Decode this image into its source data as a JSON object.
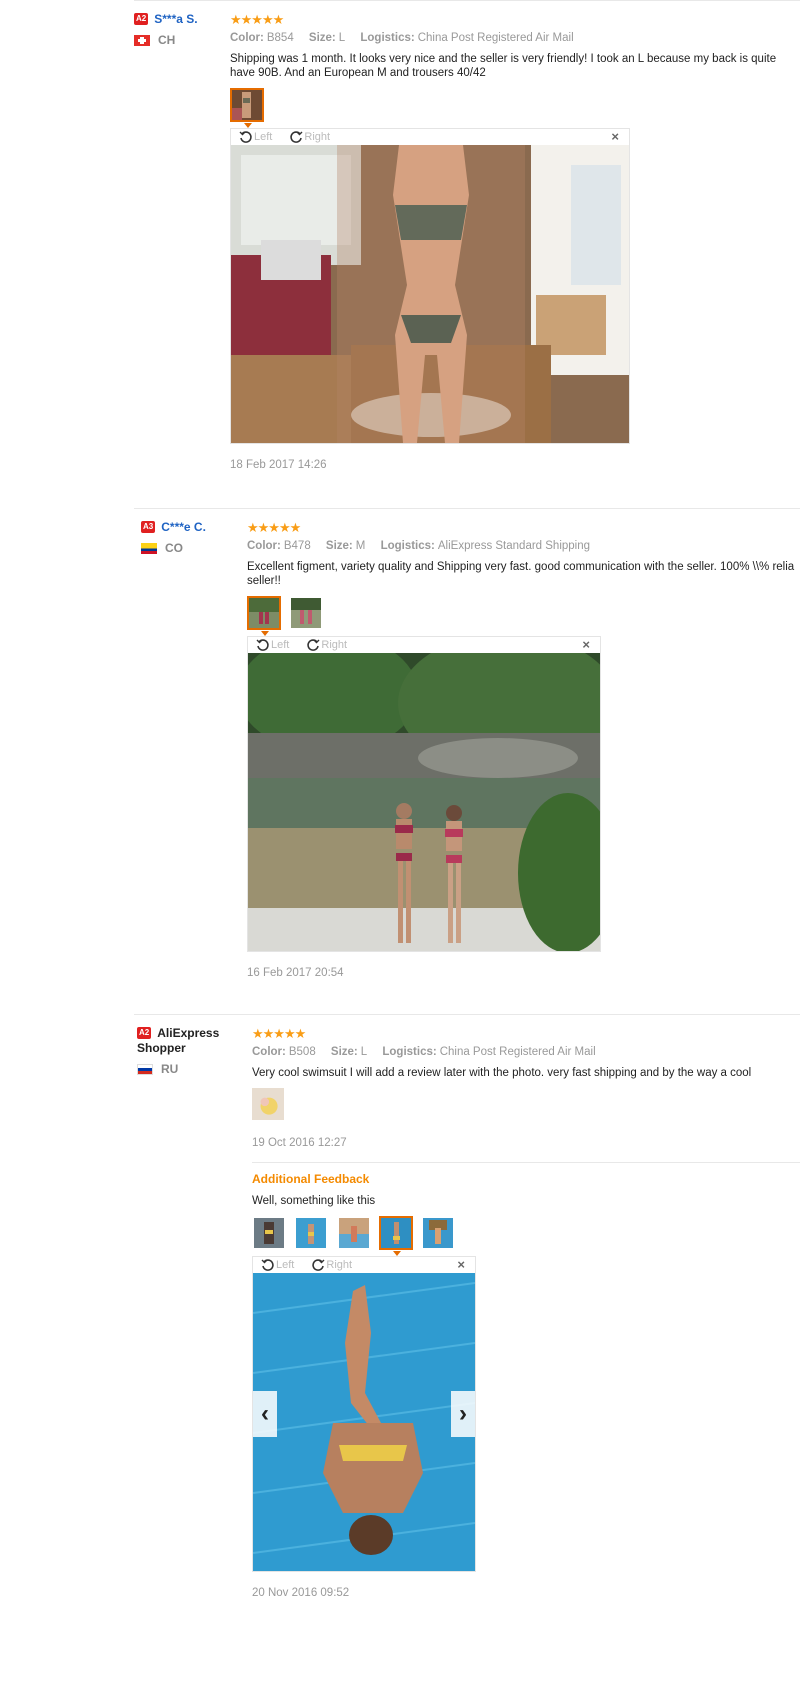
{
  "reviews": [
    {
      "badge": "A2",
      "user": "S***a S.",
      "country": "CH",
      "stars": "★★★★★",
      "color_label": "Color:",
      "color": "B854",
      "size_label": "Size:",
      "size": "L",
      "logistics_label": "Logistics:",
      "logistics": "China Post Registered Air Mail",
      "text": "Shipping was 1 month. It looks very nice and the seller is very friendly! I took an L because my back is quite\nhave 90B. And an European M and trousers 40/42",
      "left_label": "Left",
      "right_label": "Right",
      "close": "×",
      "date": "18 Feb 2017 14:26"
    },
    {
      "badge": "A3",
      "user": "C***e C.",
      "country": "CO",
      "stars": "★★★★★",
      "color_label": "Color:",
      "color": "B478",
      "size_label": "Size:",
      "size": "M",
      "logistics_label": "Logistics:",
      "logistics": "AliExpress Standard Shipping",
      "text": "Excellent figment, variety quality and Shipping very fast. good communication with the seller. 100% \\\\% relia\nseller!!",
      "left_label": "Left",
      "right_label": "Right",
      "close": "×",
      "date": "16 Feb 2017 20:54"
    },
    {
      "badge": "A2",
      "user": "AliExpress Shopper",
      "country": "RU",
      "stars": "★★★★★",
      "color_label": "Color:",
      "color": "B508",
      "size_label": "Size:",
      "size": "L",
      "logistics_label": "Logistics:",
      "logistics": "China Post Registered Air Mail",
      "text": "Very cool swimsuit I will add a review later with the photo. very fast shipping and by the way a cool",
      "date": "19 Oct 2016 12:27",
      "additional": {
        "title": "Additional Feedback",
        "text": "Well, something like this",
        "left_label": "Left",
        "right_label": "Right",
        "close": "×",
        "prev": "‹",
        "next": "›",
        "date": "20 Nov 2016 09:52"
      }
    }
  ]
}
